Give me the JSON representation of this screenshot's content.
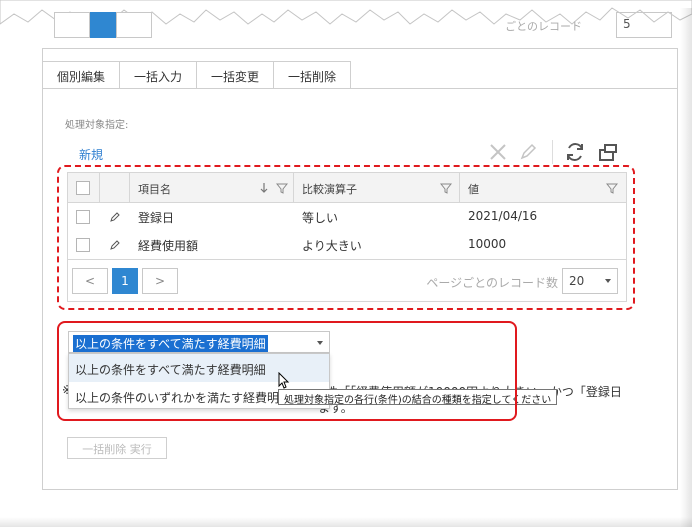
{
  "tabs": [
    {
      "label": "個別編集"
    },
    {
      "label": "一括入力"
    },
    {
      "label": "一括変更"
    },
    {
      "label": "一括削除"
    }
  ],
  "top_pager": {
    "record_label_fragment": "ごとのレコード",
    "page_size": "5"
  },
  "section_caption": "処理対象指定:",
  "new_link": "新規",
  "grid": {
    "columns": [
      "項目名",
      "比較演算子",
      "値"
    ],
    "rows": [
      {
        "field": "登録日",
        "operator": "等しい",
        "value": "2021/04/16"
      },
      {
        "field": "経費使用額",
        "operator": "より大きい",
        "value": "10000"
      }
    ],
    "pager": {
      "prev": "<",
      "current_page": "1",
      "next": ">",
      "records_label": "ページごとのレコード数",
      "page_size": "20"
    }
  },
  "combo": {
    "selected": "以上の条件をすべて満たす経費明細",
    "options": [
      "以上の条件をすべて満たす経費明細",
      "以上の条件のいずれかを満たす経費明細"
    ]
  },
  "description": {
    "mark": "※",
    "line1_fragment": "条件「「経費使用額が10000円より大きい」かつ「登録日",
    "line2_fragment": "ます。"
  },
  "tooltip": "処理対象指定の各行(条件)の結合の種類を指定してください",
  "execute_button": "一括削除 実行",
  "colors": {
    "accent": "#2f87d1",
    "highlight": "#e0191e",
    "selection": "#1a6fd1"
  }
}
